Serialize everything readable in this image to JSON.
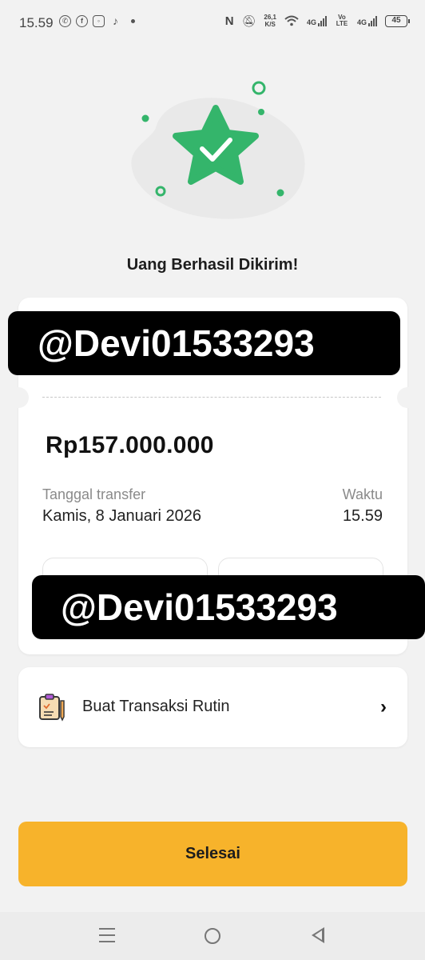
{
  "status_bar": {
    "time": "15.59",
    "speed_value": "26,1",
    "speed_unit": "K/S",
    "net1": "4G",
    "volte": "Vo LTE",
    "net2": "4G",
    "battery": "45"
  },
  "title": "Uang Berhasil Dikirim!",
  "watermark": "@Devi01533293",
  "receipt": {
    "amount": "Rp157.000.000",
    "date_label": "Tanggal transfer",
    "date_value": "Kamis, 8 Januari 2026",
    "time_label": "Waktu",
    "time_value": "15.59"
  },
  "routine": {
    "label": "Buat Transaksi Rutin",
    "icon": "clipboard-pencil-icon"
  },
  "done_button": "Selesai",
  "colors": {
    "accent": "#f7b32b",
    "success_green": "#34b56b",
    "background": "#f2f2f2"
  }
}
